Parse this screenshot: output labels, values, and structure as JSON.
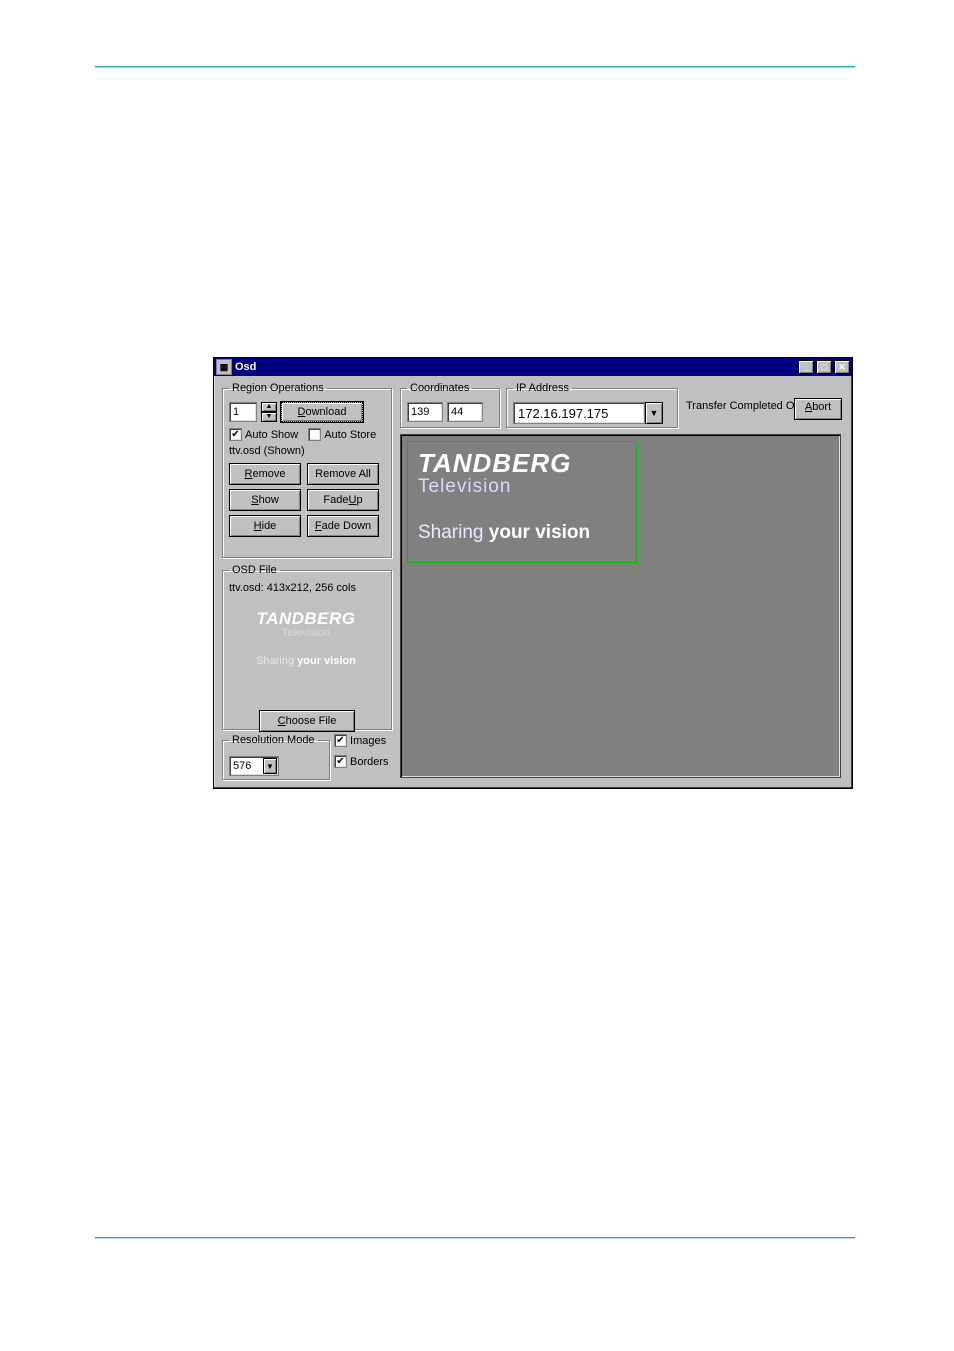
{
  "window": {
    "title": "Osd"
  },
  "region": {
    "legend": "Region Operations",
    "spinner_value": "1",
    "download_label": "Download",
    "auto_show_label": "Auto Show",
    "auto_show_checked": true,
    "auto_store_label": "Auto Store",
    "auto_store_checked": false,
    "status_text": "ttv.osd (Shown)",
    "remove_label": "Remove",
    "remove_all_label": "Remove All",
    "show_label": "Show",
    "fade_up_label": "Fade Up",
    "hide_label": "Hide",
    "fade_down_label": "Fade Down"
  },
  "coordinates": {
    "legend": "Coordinates",
    "x": "139",
    "y": "44"
  },
  "ip": {
    "legend": "IP Address",
    "value": "172.16.197.175"
  },
  "transfer": {
    "status": "Transfer Completed OK",
    "abort_label": "Abort"
  },
  "osd_file": {
    "legend": "OSD File",
    "info": "ttv.osd: 413x212, 256 cols",
    "choose_label": "Choose File"
  },
  "resolution": {
    "legend": "Resolution Mode",
    "value": "576",
    "images_label": "Images",
    "images_checked": true,
    "borders_label": "Borders",
    "borders_checked": true
  },
  "logo": {
    "brand": "TANDBERG",
    "subtitle": "Television",
    "tagline_prefix": "Sharing ",
    "tagline_bold": "your vision"
  }
}
